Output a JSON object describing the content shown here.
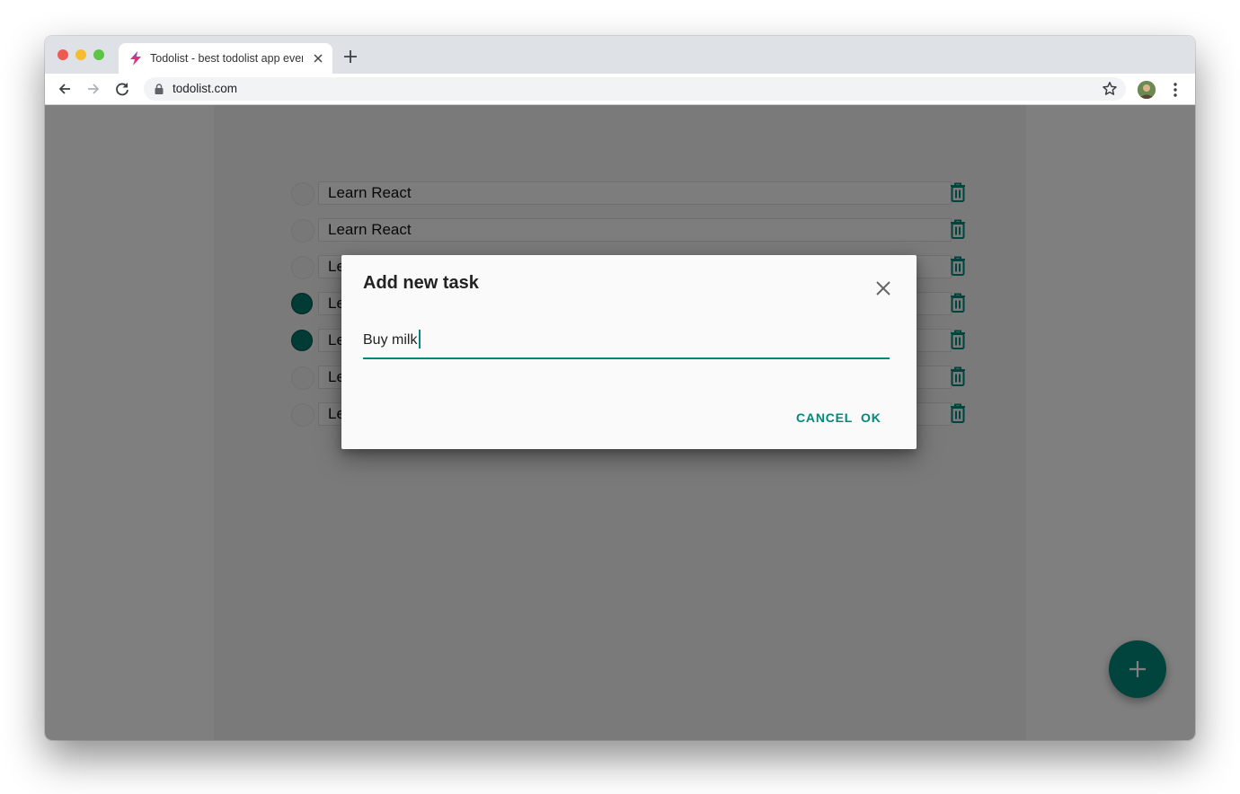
{
  "browser": {
    "tab_title": "Todolist - best todolist app ever",
    "url": "todolist.com"
  },
  "todos": [
    {
      "text": "Learn React",
      "done": false
    },
    {
      "text": "Learn React",
      "done": false
    },
    {
      "text": "Le",
      "done": false
    },
    {
      "text": "Le",
      "done": true
    },
    {
      "text": "Le",
      "done": true
    },
    {
      "text": "Le",
      "done": false
    },
    {
      "text": "Le",
      "done": false
    }
  ],
  "dialog": {
    "title": "Add new task",
    "input_value": "Buy milk",
    "cancel_label": "CANCEL",
    "ok_label": "OK"
  },
  "colors": {
    "accent": "#00897b",
    "checked": "#00796b"
  },
  "icons": {
    "close": "close-icon",
    "trash": "trash-icon",
    "add": "plus-icon"
  }
}
